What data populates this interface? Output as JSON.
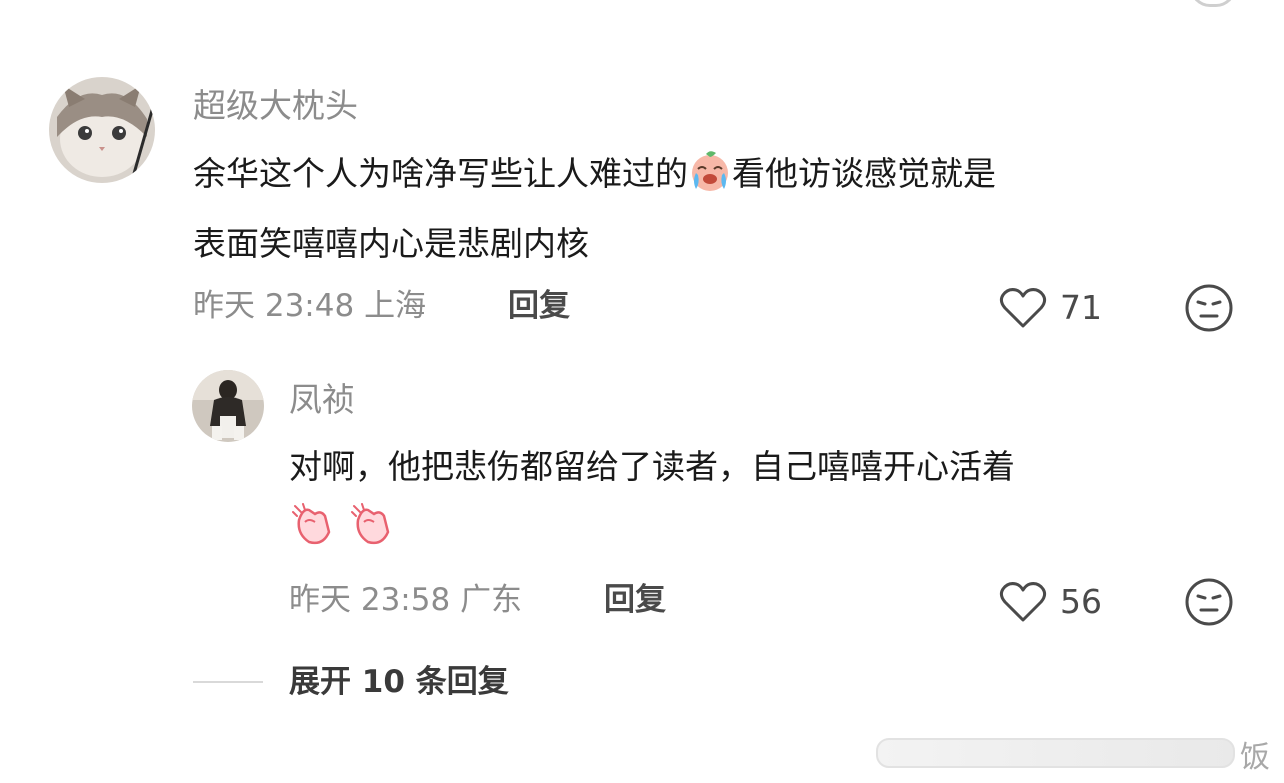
{
  "comment": {
    "username": "超级大枕头",
    "text_line1_a": "余华这个人为啥净写些让人难过的",
    "text_line1_b": "看他访谈感觉就是",
    "text_line2": "表面笑嘻嘻内心是悲剧内核",
    "emoji_icon": "crying-face-emoji",
    "date": "昨天",
    "time": "23:48",
    "location": "上海",
    "reply_label": "回复",
    "like_count": "71"
  },
  "reply": {
    "username": "凤祯",
    "text_line1": "对啊，他把悲伤都留给了读者，自己嘻嘻开心活着",
    "emoji_icons": [
      "clapping-hands-emoji",
      "clapping-hands-emoji"
    ],
    "date": "昨天",
    "time": "23:58",
    "location": "广东",
    "reply_label": "回复",
    "like_count": "56"
  },
  "expand_label": "展开 10 条回复",
  "watermark_text": "饭",
  "colors": {
    "secondary_text": "#8c8c8c",
    "primary_text": "#1a1a1a",
    "icon_gray": "#4a4a4a"
  }
}
